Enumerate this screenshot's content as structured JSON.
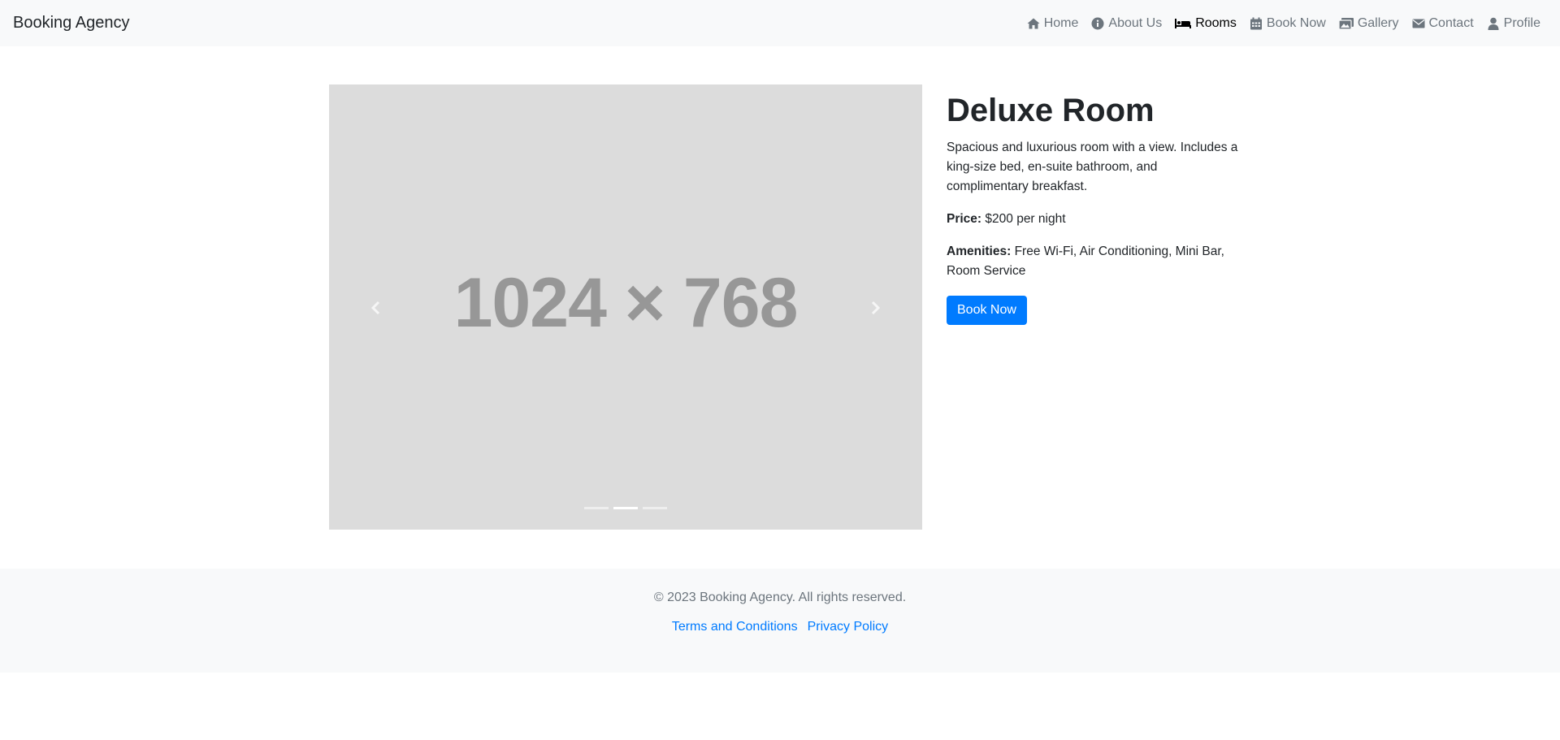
{
  "navbar": {
    "brand": "Booking Agency",
    "items": [
      {
        "label": "Home",
        "icon": "home-icon",
        "active": false
      },
      {
        "label": "About Us",
        "icon": "info-icon",
        "active": false
      },
      {
        "label": "Rooms",
        "icon": "bed-icon",
        "active": true
      },
      {
        "label": "Book Now",
        "icon": "calendar-icon",
        "active": false
      },
      {
        "label": "Gallery",
        "icon": "images-icon",
        "active": false
      },
      {
        "label": "Contact",
        "icon": "envelope-icon",
        "active": false
      },
      {
        "label": "Profile",
        "icon": "user-icon",
        "active": false
      }
    ]
  },
  "carousel": {
    "placeholder": "1024 × 768",
    "slides": 3,
    "active_index": 1,
    "prev_icon": "chevron-left-icon",
    "next_icon": "chevron-right-icon"
  },
  "room": {
    "title": "Deluxe Room",
    "description": "Spacious and luxurious room with a view. Includes a king-size bed, en-suite bathroom, and complimentary breakfast.",
    "price_label": "Price:",
    "price_value": "$200 per night",
    "amenities_label": "Amenities:",
    "amenities_value": "Free Wi-Fi, Air Conditioning, Mini Bar, Room Service",
    "book_button": "Book Now"
  },
  "footer": {
    "copyright": "© 2023 Booking Agency. All rights reserved.",
    "links": [
      "Terms and Conditions",
      "Privacy Policy"
    ]
  },
  "colors": {
    "accent": "#007bff",
    "navbar_bg": "#f8f9fa",
    "placeholder_bg": "#dcdcdc"
  }
}
